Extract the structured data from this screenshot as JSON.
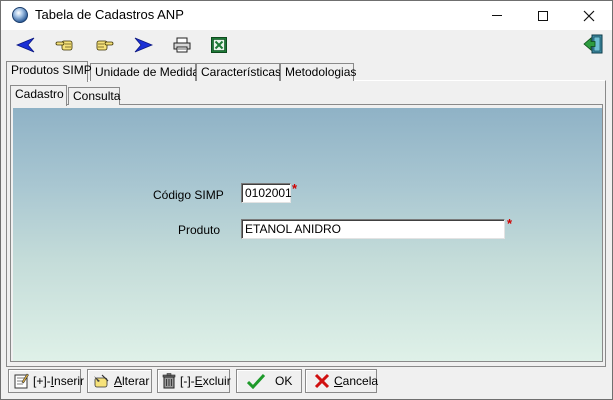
{
  "window": {
    "title": "Tabela de Cadastros ANP",
    "icon": "app-globe-icon"
  },
  "toolbar": {
    "buttons": [
      {
        "name": "back",
        "icon": "arrow-left-blue-icon"
      },
      {
        "name": "hand-left",
        "icon": "pointing-hand-left-icon"
      },
      {
        "name": "hand-right",
        "icon": "pointing-hand-right-icon"
      },
      {
        "name": "forward",
        "icon": "arrow-right-blue-icon"
      },
      {
        "name": "print",
        "icon": "printer-icon"
      },
      {
        "name": "excel",
        "icon": "excel-icon"
      },
      {
        "name": "exit",
        "icon": "exit-door-icon"
      }
    ]
  },
  "tabs_main": [
    {
      "label": "Produtos SIMP",
      "active": true
    },
    {
      "label": "Unidade de Medida",
      "active": false
    },
    {
      "label": "Características",
      "active": false
    },
    {
      "label": "Metodologias",
      "active": false
    }
  ],
  "tabs_sub": [
    {
      "label": "Cadastro",
      "active": true
    },
    {
      "label": "Consulta",
      "active": false
    }
  ],
  "form": {
    "codigo_label": "Código SIMP",
    "codigo_value": "0102001",
    "produto_label": "Produto",
    "produto_value": "ETANOL ANIDRO",
    "required_mark": "*"
  },
  "actions": {
    "inserir_prefix": "[+]-",
    "inserir_key": "I",
    "inserir_rest": "nserir",
    "alterar_key": "A",
    "alterar_rest": "lterar",
    "excluir_prefix": "[-]-",
    "excluir_key": "E",
    "excluir_rest": "xcluir",
    "ok_label": "OK",
    "cancela_key": "C",
    "cancela_rest": "ancela"
  },
  "colors": {
    "required": "#d00000",
    "gradient_top": "#8fb2c6",
    "gradient_bottom": "#dff1e8"
  }
}
